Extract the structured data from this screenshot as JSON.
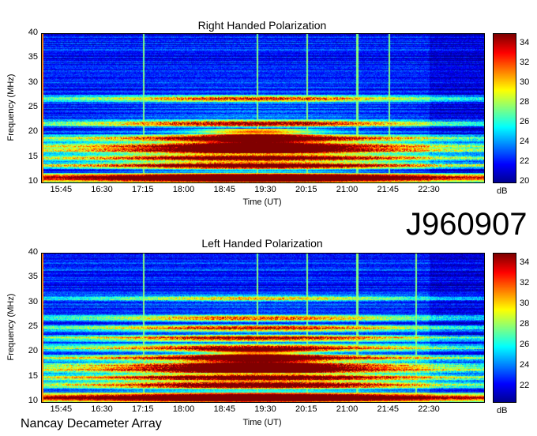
{
  "chart_data": [
    {
      "type": "heatmap",
      "title": "Right Handed Polarization",
      "xlabel": "Time (UT)",
      "ylabel": "Frequency (MHz)",
      "x_ticks": [
        "15:45",
        "16:30",
        "17:15",
        "18:00",
        "18:45",
        "19:30",
        "20:15",
        "21:00",
        "21:45",
        "22:30"
      ],
      "y_ticks": [
        "10",
        "15",
        "20",
        "25",
        "30",
        "35",
        "40"
      ],
      "ylim": [
        10,
        40
      ],
      "colorbar": {
        "label": "dB",
        "ticks": [
          "20",
          "22",
          "24",
          "26",
          "28",
          "30",
          "32",
          "34"
        ],
        "range": [
          20,
          35
        ]
      },
      "emission_bands_mhz": [
        11,
        13.5,
        15,
        16.5,
        17.5,
        19,
        22,
        27
      ],
      "vertical_lines_ut": [
        "17:15",
        "19:20",
        "20:15",
        "21:10",
        "21:45"
      ]
    },
    {
      "type": "heatmap",
      "title": "Left Handed Polarization",
      "xlabel": "Time (UT)",
      "ylabel": "Frequency (MHz)",
      "x_ticks": [
        "15:45",
        "16:30",
        "17:15",
        "18:00",
        "18:45",
        "19:30",
        "20:15",
        "21:00",
        "21:45",
        "22:30"
      ],
      "y_ticks": [
        "10",
        "15",
        "20",
        "25",
        "30",
        "35",
        "40"
      ],
      "ylim": [
        10,
        40
      ],
      "colorbar": {
        "label": "dB",
        "ticks": [
          "22",
          "24",
          "26",
          "28",
          "30",
          "32",
          "34"
        ],
        "range": [
          20.5,
          35
        ]
      },
      "emission_bands_mhz": [
        11,
        13.5,
        15,
        16.5,
        17.5,
        19,
        21,
        23,
        25,
        27,
        31
      ],
      "vertical_lines_ut": [
        "17:15",
        "19:20",
        "20:15",
        "21:10",
        "22:15"
      ]
    }
  ],
  "observation_id": "J960907",
  "instrument": "Nancay Decameter Array",
  "colormap": [
    "#00008f",
    "#0000ff",
    "#0080ff",
    "#00ffff",
    "#80ff80",
    "#ffff00",
    "#ff8000",
    "#ff0000",
    "#800000"
  ]
}
